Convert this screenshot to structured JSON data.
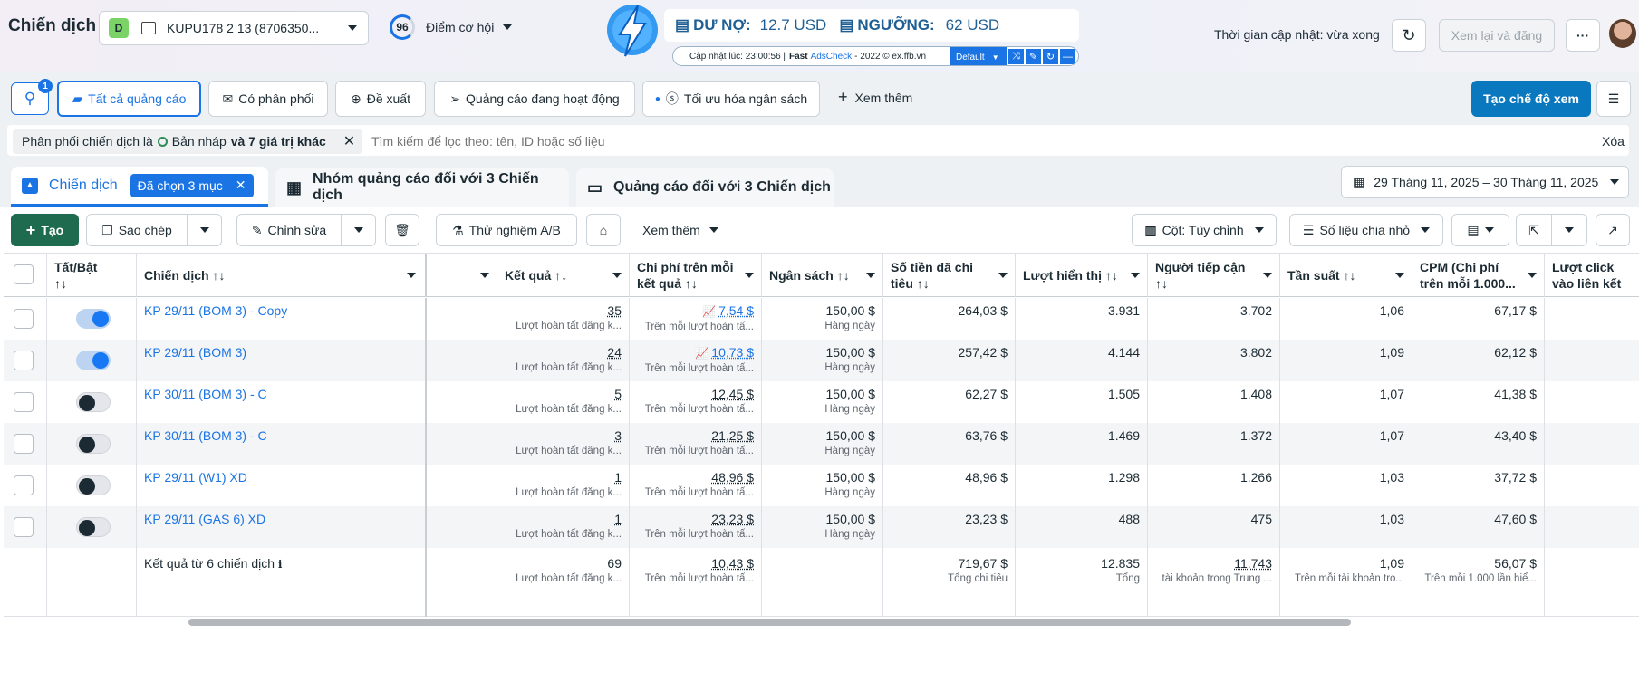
{
  "header": {
    "title": "Chiến dịch",
    "account_badge": "D",
    "account_name": "KUPU178 2 13 (8706350...",
    "score": "96",
    "score_label": "Điểm cơ hội",
    "update_label": "Thời gian cập nhật: vừa xong",
    "review_button": "Xem lại và đăng"
  },
  "adscheck": {
    "debt_label": "DƯ NỢ:",
    "debt_value": "12.7 USD",
    "threshold_label": "NGƯỠNG:",
    "threshold_value": "62 USD",
    "updated": "Cập nhật lúc: 23:00:56 |",
    "brand_fast": "Fast",
    "brand_name": "AdsCheck",
    "brand_rest": "- 2022 © ex.ffb.vn",
    "mode": "Default"
  },
  "filters": {
    "search_badge": "1",
    "tabs": [
      "Tất cả quảng cáo",
      "Có phân phối",
      "Đề xuất",
      "Quảng cáo đang hoạt động",
      "Tối ưu hóa ngân sách"
    ],
    "more": "Xem thêm",
    "create_view": "Tạo chế độ xem",
    "chip_prefix": "Phân phối chiến dịch là",
    "chip_value": "Bản nháp",
    "chip_more": "và 7 giá trị khác",
    "search_placeholder": "Tìm kiếm để lọc theo: tên, ID hoặc số liệu",
    "clear": "Xóa"
  },
  "level_tabs": {
    "campaigns": "Chiến dịch",
    "selected": "Đã chọn 3 mục",
    "adsets": "Nhóm quảng cáo đối với 3 Chiến dịch",
    "ads": "Quảng cáo đối với 3 Chiến dịch",
    "date_range": "29 Tháng 11, 2025 – 30 Tháng 11, 2025"
  },
  "toolbar": {
    "create": "Tạo",
    "duplicate": "Sao chép",
    "edit": "Chỉnh sửa",
    "ab_test": "Thử nghiệm A/B",
    "more": "Xem thêm",
    "columns": "Cột: Tùy chỉnh",
    "breakdown": "Số liệu chia nhỏ"
  },
  "columns": {
    "toggle": "Tất/Bật",
    "name": "Chiến dịch",
    "results": "Kết quả",
    "cpr": "Chi phí trên mỗi kết quả",
    "budget": "Ngân sách",
    "spent": "Số tiền đã chi tiêu",
    "impressions": "Lượt hiển thị",
    "reach": "Người tiếp cận",
    "frequency": "Tần suất",
    "cpm": "CPM (Chi phí trên mỗi 1.000...",
    "clicks": "Lượt click vào liên kết"
  },
  "rows": [
    {
      "name": "KP 29/11 (BOM 3) - Copy",
      "on": true,
      "results": "35",
      "results_sub": "Lượt hoàn tất đăng k...",
      "cpr": "7,54 $",
      "cpr_sub": "Trên mỗi lượt hoàn tấ...",
      "trend": true,
      "budget": "150,00 $",
      "budget_sub": "Hàng ngày",
      "spent": "264,03 $",
      "impressions": "3.931",
      "reach": "3.702",
      "frequency": "1,06",
      "cpm": "67,17 $"
    },
    {
      "name": "KP 29/11 (BOM 3)",
      "on": true,
      "results": "24",
      "results_sub": "Lượt hoàn tất đăng k...",
      "cpr": "10,73 $",
      "cpr_sub": "Trên mỗi lượt hoàn tấ...",
      "trend": true,
      "budget": "150,00 $",
      "budget_sub": "Hàng ngày",
      "spent": "257,42 $",
      "impressions": "4.144",
      "reach": "3.802",
      "frequency": "1,09",
      "cpm": "62,12 $"
    },
    {
      "name": "KP 30/11 (BOM 3) - C",
      "on": false,
      "results": "5",
      "results_sub": "Lượt hoàn tất đăng k...",
      "cpr": "12,45 $",
      "cpr_sub": "Trên mỗi lượt hoàn tấ...",
      "trend": false,
      "budget": "150,00 $",
      "budget_sub": "Hàng ngày",
      "spent": "62,27 $",
      "impressions": "1.505",
      "reach": "1.408",
      "frequency": "1,07",
      "cpm": "41,38 $"
    },
    {
      "name": "KP 30/11 (BOM 3) - C",
      "on": false,
      "results": "3",
      "results_sub": "Lượt hoàn tất đăng k...",
      "cpr": "21,25 $",
      "cpr_sub": "Trên mỗi lượt hoàn tấ...",
      "trend": false,
      "budget": "150,00 $",
      "budget_sub": "Hàng ngày",
      "spent": "63,76 $",
      "impressions": "1.469",
      "reach": "1.372",
      "frequency": "1,07",
      "cpm": "43,40 $"
    },
    {
      "name": "KP 29/11 (W1) XD",
      "on": false,
      "results": "1",
      "results_sub": "Lượt hoàn tất đăng k...",
      "cpr": "48,96 $",
      "cpr_sub": "Trên mỗi lượt hoàn tấ...",
      "trend": false,
      "budget": "150,00 $",
      "budget_sub": "Hàng ngày",
      "spent": "48,96 $",
      "impressions": "1.298",
      "reach": "1.266",
      "frequency": "1,03",
      "cpm": "37,72 $"
    },
    {
      "name": "KP 29/11 (GAS 6) XD",
      "on": false,
      "results": "1",
      "results_sub": "Lượt hoàn tất đăng k...",
      "cpr": "23,23 $",
      "cpr_sub": "Trên mỗi lượt hoàn tấ...",
      "trend": false,
      "budget": "150,00 $",
      "budget_sub": "Hàng ngày",
      "spent": "23,23 $",
      "impressions": "488",
      "reach": "475",
      "frequency": "1,03",
      "cpm": "47,60 $"
    }
  ],
  "summary": {
    "label": "Kết quả từ 6 chiến dịch",
    "results": "69",
    "results_sub": "Lượt hoàn tất đăng k...",
    "cpr": "10,43 $",
    "cpr_sub": "Trên mỗi lượt hoàn tấ...",
    "spent": "719,67 $",
    "spent_sub": "Tổng chi tiêu",
    "impressions": "12.835",
    "impressions_sub": "Tổng",
    "reach": "11.743",
    "reach_sub": "tài khoản trong Trung ...",
    "frequency": "1,09",
    "frequency_sub": "Trên mỗi tài khoản tro...",
    "cpm": "56,07 $",
    "cpm_sub": "Trên mỗi 1.000 lần hiể..."
  }
}
